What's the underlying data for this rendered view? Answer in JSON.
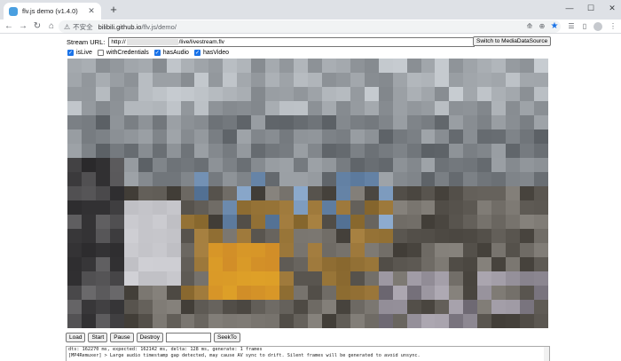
{
  "browser": {
    "tab_title": "flv.js demo (v1.4.0)",
    "tab_close": "✕",
    "new_tab": "+",
    "window_controls": [
      "—",
      "☐",
      "✕"
    ],
    "nav": {
      "back": "←",
      "forward": "→",
      "reload": "↻",
      "home": "⌂"
    },
    "omnibox": {
      "warning_icon": "⚠",
      "insecure_label": "不安全",
      "host": "bilibili.github.io",
      "path": "/flv.js/demo/"
    },
    "toolbar_icons": [
      "translate-icon",
      "zoom-icon",
      "bookmark-star-icon",
      "reading-list-icon",
      "extensions-icon",
      "sidepanel-icon",
      "profile-avatar",
      "menu-icon"
    ]
  },
  "page": {
    "stream_url_label": "Stream URL:",
    "stream_url_prefix": "http://",
    "stream_url_suffix": "/live/livestream.flv",
    "switch_button": "Switch to MediaDataSource",
    "options": [
      {
        "label": "isLive",
        "checked": true
      },
      {
        "label": "withCredentials",
        "checked": false
      },
      {
        "label": "hasAudio",
        "checked": true
      },
      {
        "label": "hasVideo",
        "checked": true
      }
    ],
    "buttons": {
      "load": "Load",
      "start": "Start",
      "pause": "Pause",
      "destroy": "Destroy",
      "seek": "SeekTo"
    },
    "seek_value": "",
    "log_lines": [
      "dts: 162270 ms, expected: 162142 ms, delta: 128 ms, generate: 1 frames",
      "[MP4Remuxer] > Large audio timestamp gap detected, may cause AV sync to drift. Silent frames will be generated to avoid unsync."
    ]
  },
  "colors": {
    "tabstrip": "#dee1e6",
    "accent": "#1a73e8"
  }
}
